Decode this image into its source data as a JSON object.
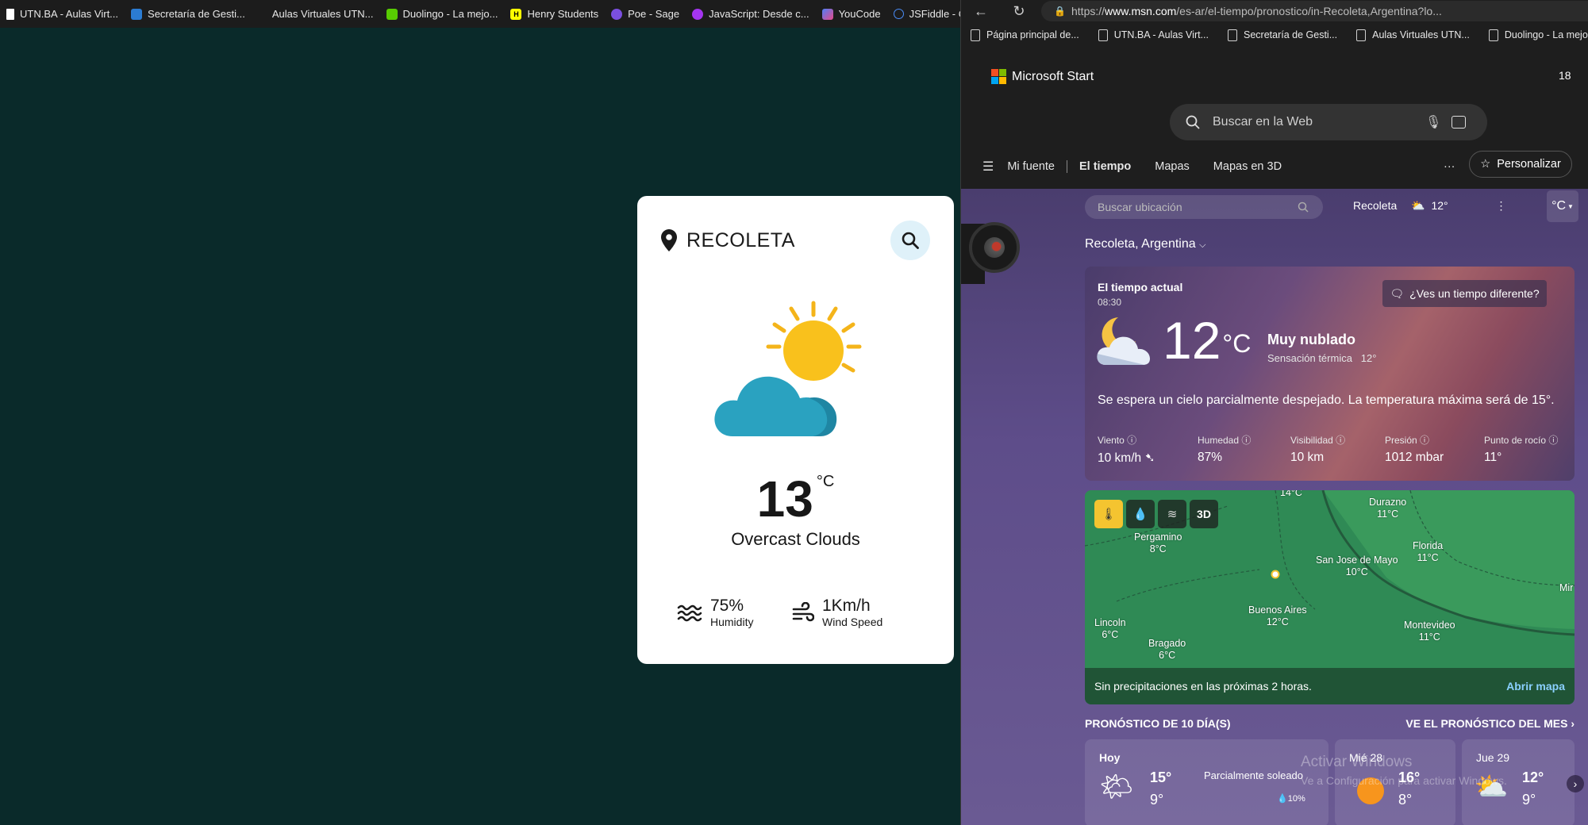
{
  "left_bookmarks": [
    {
      "label": "UTN.BA - Aulas Virt...",
      "icon": "document-icon"
    },
    {
      "label": "Secretaría de Gesti...",
      "icon": "sheet-icon"
    },
    {
      "label": "Aulas Virtuales UTN...",
      "icon": "none"
    },
    {
      "label": "Duolingo - La mejo...",
      "icon": "duolingo-icon"
    },
    {
      "label": "Henry Students",
      "icon": "henry-icon"
    },
    {
      "label": "Poe - Sage",
      "icon": "poe-icon"
    },
    {
      "label": "JavaScript: Desde c...",
      "icon": "udemy-icon"
    },
    {
      "label": "YouCode",
      "icon": "youcode-icon"
    },
    {
      "label": "JSFiddle - Code Pla...",
      "icon": "jsfiddle-icon"
    }
  ],
  "weather_card": {
    "city": "RECOLETA",
    "temperature": "13",
    "unit": "°C",
    "description": "Overcast Clouds",
    "humidity_value": "75%",
    "humidity_label": "Humidity",
    "wind_value": "1Km/h",
    "wind_label": "Wind Speed"
  },
  "browser": {
    "url_prefix": "https://",
    "url_domain": "www.msn.com",
    "url_rest": "/es-ar/el-tiempo/pronostico/in-Recoleta,Argentina?lo...",
    "bookmarks": [
      "Página principal de...",
      "UTN.BA - Aulas Virt...",
      "Secretaría de Gesti...",
      "Aulas Virtuales UTN...",
      "Duolingo - La mejo..."
    ]
  },
  "msn": {
    "brand": "Microsoft Start",
    "corner_temp": "18",
    "search_placeholder": "Buscar en la Web",
    "nav": [
      "Mi fuente",
      "El tiempo",
      "Mapas",
      "Mapas en 3D"
    ],
    "more": "···",
    "personalize": "Personalizar",
    "location_placeholder": "Buscar ubicación",
    "mini_location": "Recoleta",
    "mini_temp": "12°",
    "unit_selector": "°C",
    "location_title": "Recoleta, Argentina",
    "current": {
      "label": "El tiempo actual",
      "time": "08:30",
      "different_btn": "¿Ves un tiempo diferente?",
      "temp": "12",
      "unit": "°C",
      "condition": "Muy nublado",
      "feels_like_label": "Sensación térmica",
      "feels_like_value": "12°",
      "forecast_text": "Se espera un cielo parcialmente despejado. La temperatura máxima será de 15°.",
      "metrics": [
        {
          "label": "Viento",
          "value": "10 km/h"
        },
        {
          "label": "Humedad",
          "value": "87%"
        },
        {
          "label": "Visibilidad",
          "value": "10 km"
        },
        {
          "label": "Presión",
          "value": "1012 mbar"
        },
        {
          "label": "Punto de rocío",
          "value": "11°"
        }
      ]
    },
    "map": {
      "layer_3d": "3D",
      "cities": [
        {
          "name": "Pergamino",
          "temp": "8°C"
        },
        {
          "name": "Durazno",
          "temp": "11°C"
        },
        {
          "name": "Florida",
          "temp": "11°C"
        },
        {
          "name": "San Jose de Mayo",
          "temp": "10°C"
        },
        {
          "name": "Buenos Aires",
          "temp": "12°C"
        },
        {
          "name": "Lincoln",
          "temp": "6°C"
        },
        {
          "name": "Bragado",
          "temp": "6°C"
        },
        {
          "name": "Montevideo",
          "temp": "11°C"
        },
        {
          "name": "",
          "temp": "14°C"
        },
        {
          "name": "Mir",
          "temp": ""
        }
      ],
      "footer_text": "Sin precipitaciones en las próximas 2 horas.",
      "open_map": "Abrir mapa"
    },
    "tenday_title": "PRONÓSTICO DE 10 DÍA(S)",
    "tenday_more": "VE EL PRONÓSTICO DEL MES",
    "days": [
      {
        "name": "Hoy",
        "hi": "15°",
        "lo": "9°",
        "summary": "Parcialmente soleado",
        "precip": "10%"
      },
      {
        "name": "Mié 28",
        "hi": "16°",
        "lo": "8°"
      },
      {
        "name": "Jue 29",
        "hi": "12°",
        "lo": "9°"
      }
    ],
    "watermark_title": "Activar Windows",
    "watermark_sub": "Ve a Configuración para activar Windows."
  }
}
